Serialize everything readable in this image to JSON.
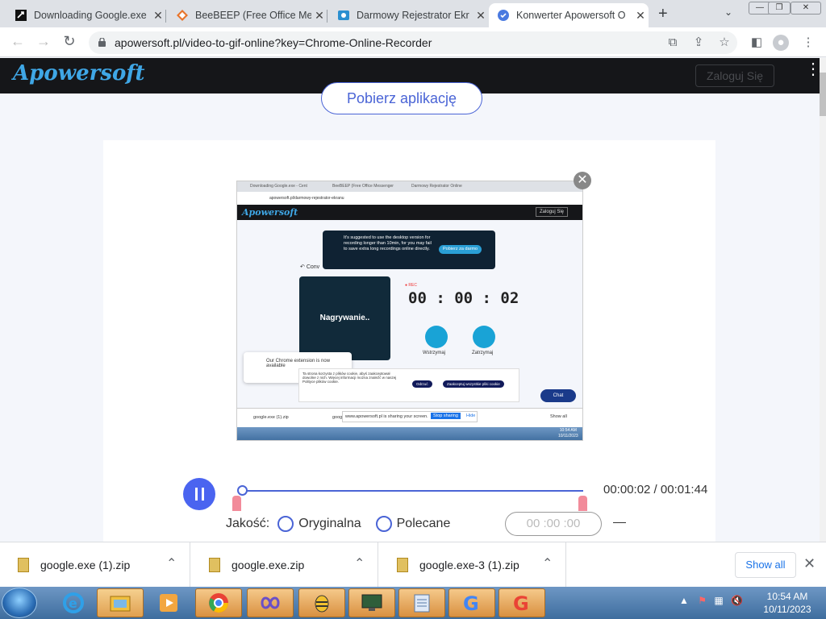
{
  "browser": {
    "tabs": [
      {
        "title": "Downloading Google.exe",
        "icon": "download-page-icon"
      },
      {
        "title": "BeeBEEP (Free Office Mes",
        "icon": "beebeep-icon"
      },
      {
        "title": "Darmowy Rejestrator Ekr",
        "icon": "recorder-icon"
      },
      {
        "title": "Konwerter Apowersoft O",
        "icon": "apowersoft-icon"
      }
    ],
    "url": "apowersoft.pl/video-to-gif-online?key=Chrome-Online-Recorder"
  },
  "site": {
    "logo": "Apowersoft",
    "login": "Zaloguj Się",
    "download_app": "Pobierz aplikację"
  },
  "preview": {
    "tabs": [
      "Downloading Google.exe - Cent",
      "BeeBEEP (Free Office Messenger",
      "Darmowy Rejestrator Online"
    ],
    "url": "apowersoft.pl/darmowy-rejestrator-ekranu",
    "logo": "Apowersoft",
    "login": "Zaloguj Się",
    "popup_text": "It's suggested to use the desktop version for recording longer than 10min, for you may fail to save extra long recordings online directly.",
    "popup_button": "Pobierz za darmo",
    "back_label": "Conv",
    "recording_label": "Nagrywanie..",
    "rec": "REC",
    "timer": "00 : 00 : 02",
    "pause": "Wstrzymaj",
    "stop": "Zatrzymaj",
    "ext_text": "Our Chrome extension is now available",
    "cookie_text": "Ta strona korzysta z plików cookie, abyś zaakceptował dowolne z nich. Więcej informacji można znaleźć w naszej Polityce plików cookie.",
    "cookie_btn1": "Odrzuć",
    "cookie_btn2": "Zaakceptuj wszystkie pliki cookie",
    "chat": "Chat",
    "share_text": "www.apowersoft.pl is sharing your screen.",
    "share_stop": "Stop sharing",
    "share_hide": "Hide",
    "dl1": "google.exe (1).zip",
    "dl2": "goog",
    "showall": "Show all",
    "clock_time": "10:54 AM",
    "clock_date": "10/11/2023"
  },
  "player": {
    "time": "00:00:02 / 00:01:44",
    "quality_label": "Jakość:",
    "opt_original": "Oryginalna",
    "opt_recommended": "Polecane",
    "time_input": "00 :00 :00",
    "progress": 0.02
  },
  "downloads": {
    "items": [
      "google.exe (1).zip",
      "google.exe.zip",
      "google.exe-3 (1).zip"
    ],
    "show_all": "Show all"
  },
  "taskbar": {
    "clock_time": "10:54 AM",
    "clock_date": "10/11/2023"
  }
}
